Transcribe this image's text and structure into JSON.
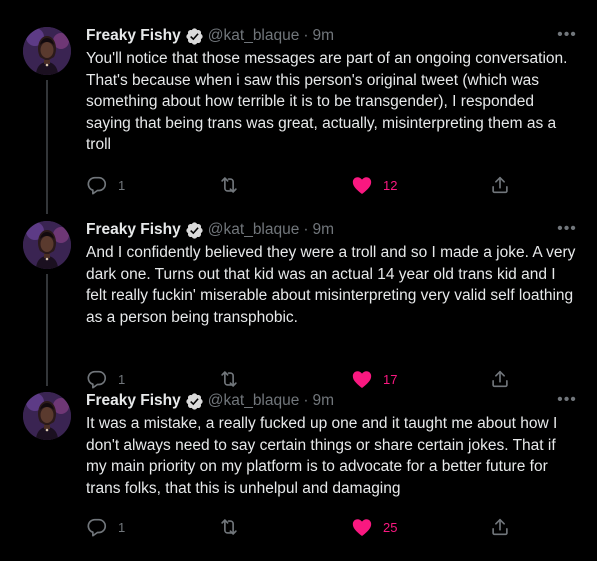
{
  "colors": {
    "background": "#000000",
    "text": "#e7e9ea",
    "muted": "#71767b",
    "verified": "#d9d9d9",
    "like": "#f91880",
    "thread_line": "#333639"
  },
  "tweets": [
    {
      "display_name": "Freaky Fishy",
      "handle": "@kat_blaque",
      "separator": "·",
      "time": "9m",
      "text": "You'll notice that those messages are part of an ongoing conversation. That's because when i saw this person's original tweet (which was something about how terrible it is to be transgender), I responded saying that being trans was great, actually, misinterpreting them as a troll",
      "reply_count": "1",
      "like_count": "12",
      "liked": true
    },
    {
      "display_name": "Freaky Fishy",
      "handle": "@kat_blaque",
      "separator": "·",
      "time": "9m",
      "text": "And I confidently believed they were a troll and so I made a joke. A very dark one. Turns out that kid was an actual 14 year old trans kid and I felt really fuckin' miserable about misinterpreting very valid self loathing as a person being transphobic.",
      "reply_count": "1",
      "like_count": "17",
      "liked": true
    },
    {
      "display_name": "Freaky Fishy",
      "handle": "@kat_blaque",
      "separator": "·",
      "time": "9m",
      "text": "It was a mistake, a really fucked up one and it taught me about how I don't always need to say certain things or share certain jokes. That if my main priority on my platform is to advocate for a better future for trans folks, that this is unhelpul and damaging",
      "reply_count": "1",
      "like_count": "25",
      "liked": true
    }
  ],
  "icons": {
    "avatar": "avatar",
    "verified": "verified-badge-icon",
    "more": "more-dots-icon",
    "reply": "reply-icon",
    "retweet": "retweet-icon",
    "like": "heart-icon",
    "share": "share-icon"
  }
}
